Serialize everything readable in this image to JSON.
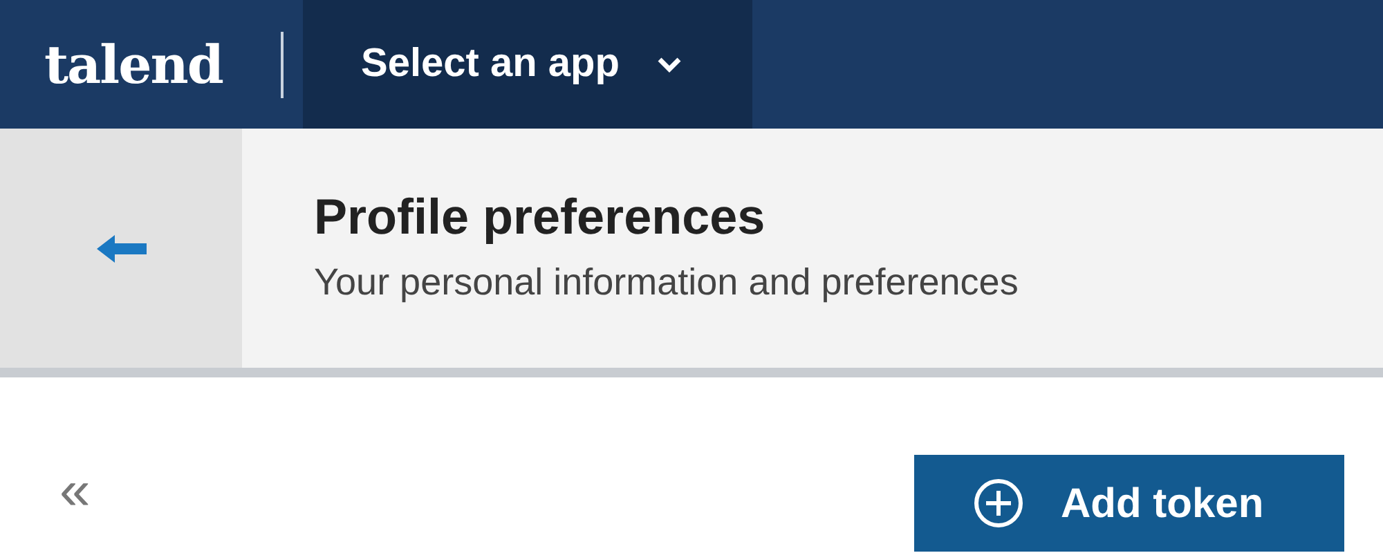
{
  "top_bar": {
    "logo": "talend",
    "app_selector": {
      "label": "Select an app",
      "expanded": false
    }
  },
  "header": {
    "title": "Profile preferences",
    "subtitle": "Your personal information and preferences"
  },
  "content": {
    "collapse": "«",
    "add_button": {
      "label": "Add token"
    }
  }
}
